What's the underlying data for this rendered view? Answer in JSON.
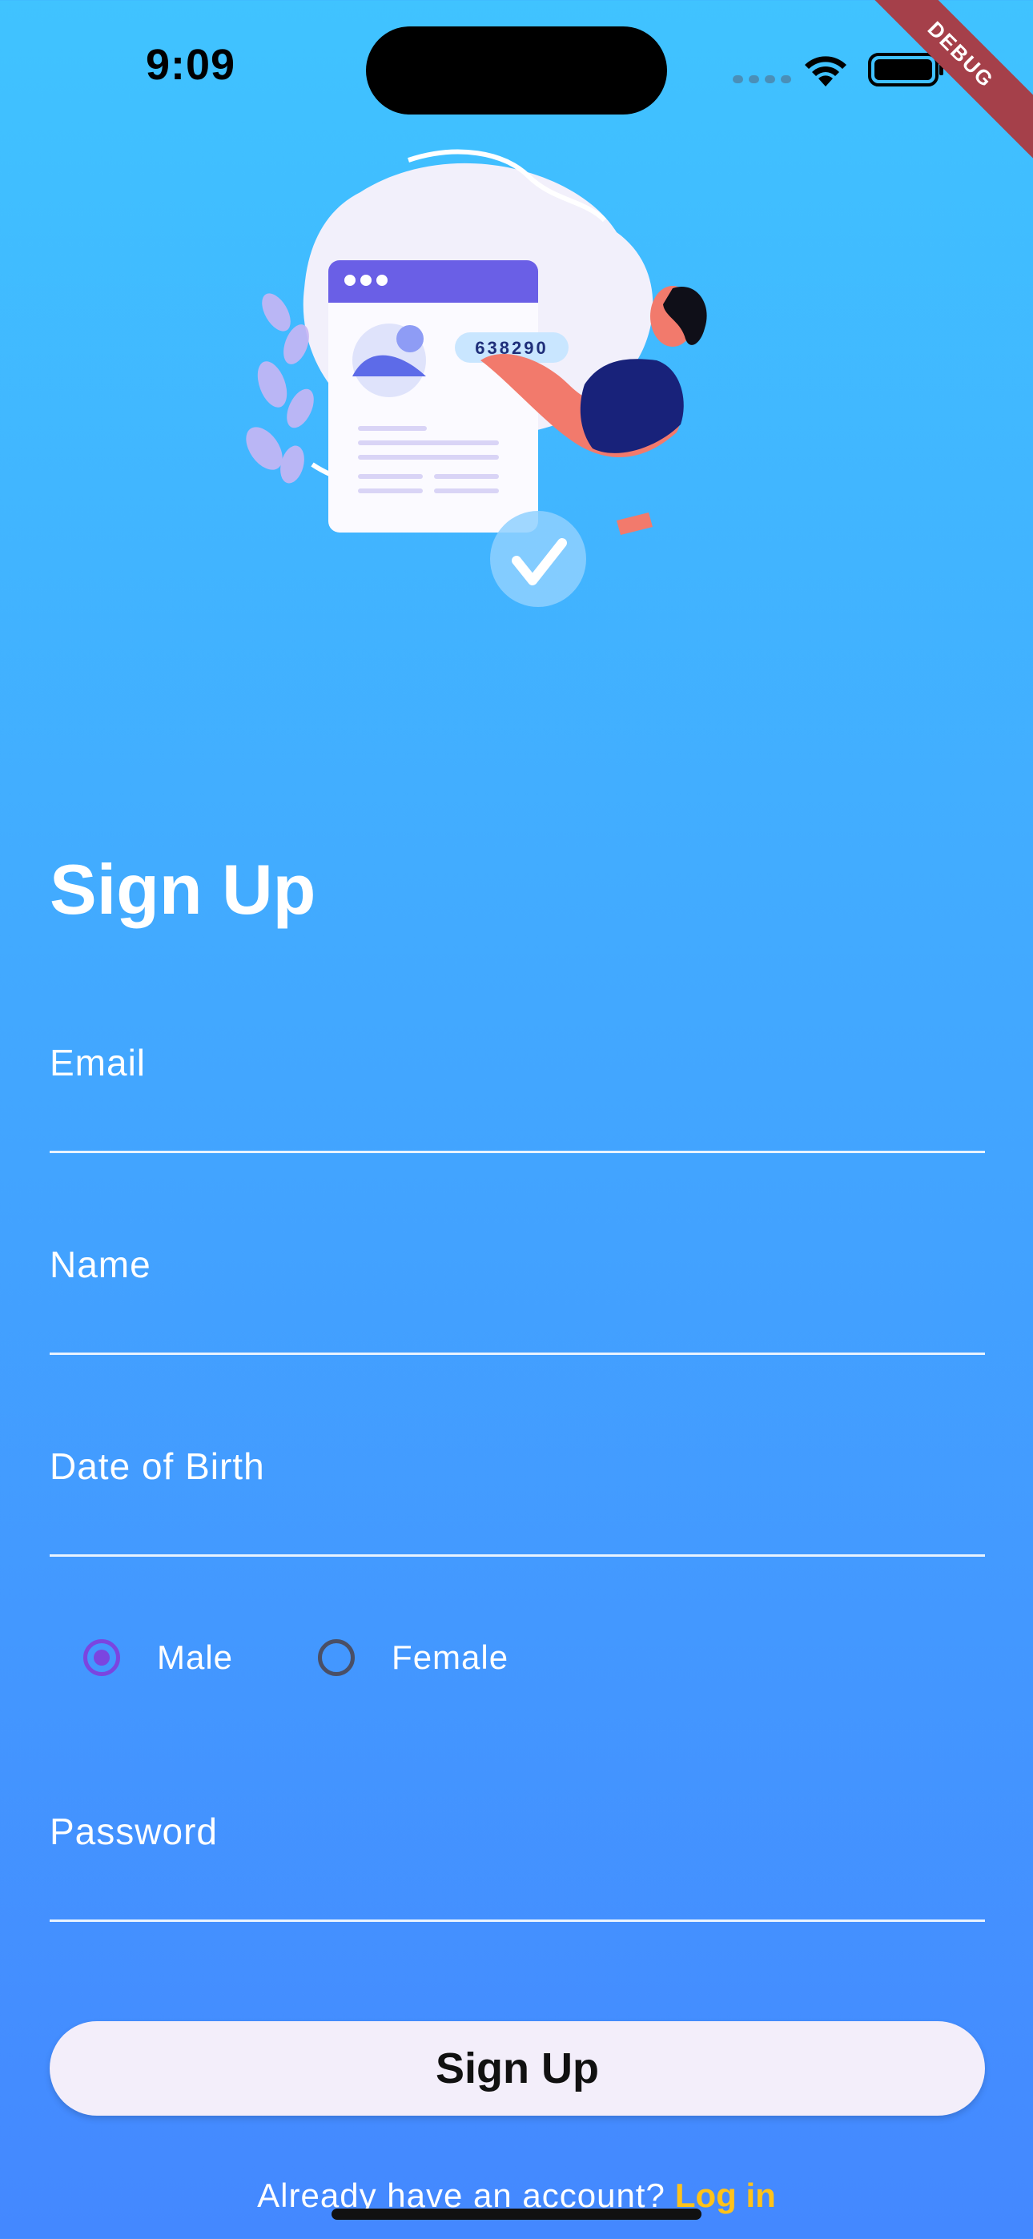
{
  "status_bar": {
    "time": "9:09",
    "debug_label": "DEBUG"
  },
  "illustration": {
    "code_text": "638290"
  },
  "page": {
    "title": "Sign Up"
  },
  "form": {
    "email_label": "Email",
    "name_label": "Name",
    "dob_label": "Date of Birth",
    "gender": {
      "options": [
        {
          "label": "Male",
          "selected": true
        },
        {
          "label": "Female",
          "selected": false
        }
      ]
    },
    "password_label": "Password",
    "submit_label": "Sign Up"
  },
  "footer": {
    "prompt": "Already have an account?",
    "login_label": "Log in"
  },
  "colors": {
    "accent_radio": "#7b45e0",
    "login_link": "#ffc21a",
    "button_bg": "#f3eefa"
  }
}
